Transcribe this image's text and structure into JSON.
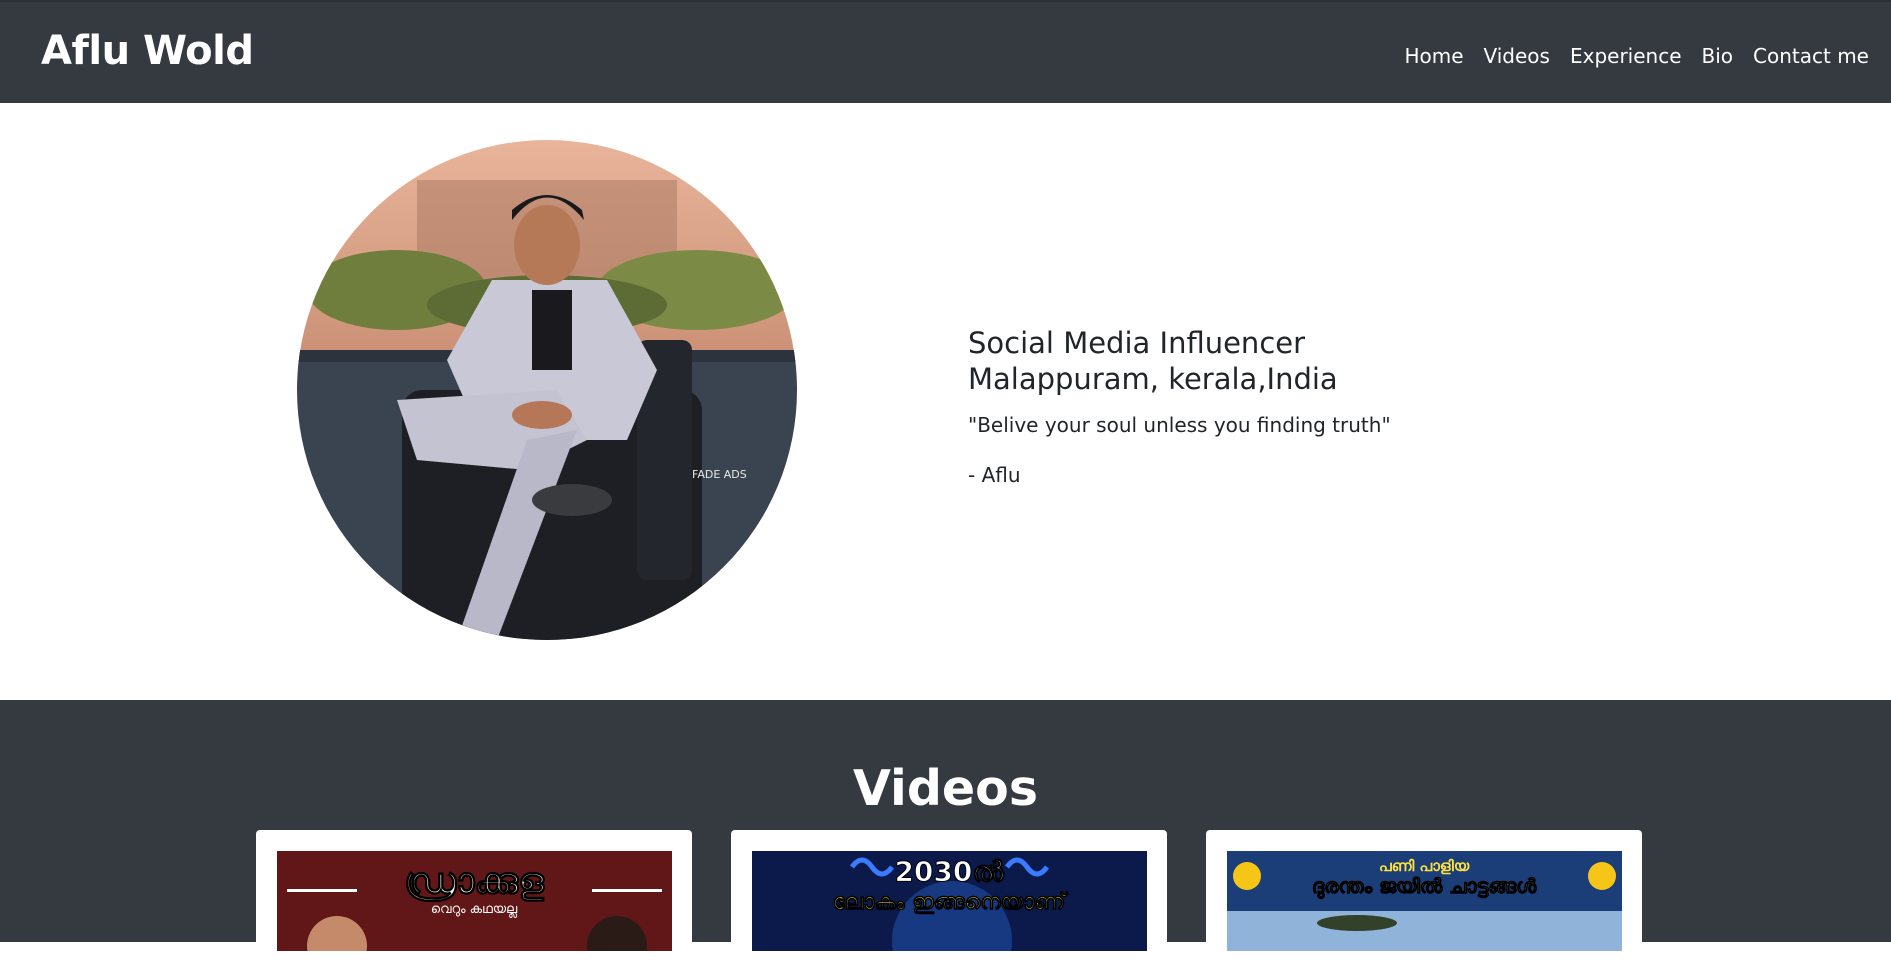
{
  "navbar": {
    "brand": "Aflu Wold",
    "links": [
      "Home",
      "Videos",
      "Experience",
      "Bio",
      "Contact me"
    ]
  },
  "hero": {
    "title_line1": "Social Media Influencer",
    "title_line2": "Malappuram, kerala,India",
    "quote": "\"Belive your soul unless you finding truth\"",
    "author": "- Aflu",
    "photo_watermark": "FADE ADS"
  },
  "videos": {
    "heading": "Videos",
    "cards": [
      {
        "title": "ഡ്രാക്കുള",
        "subtitle": "വെറും കഥയല്ല"
      },
      {
        "title": "2030ൽ",
        "subtitle": "ലോകം ഇങ്ങനെയാണ്"
      },
      {
        "title": "പണി പാളിയ",
        "subtitle": "ദുരന്തം ജയിൽ ചാട്ടങ്ങൾ"
      }
    ]
  },
  "colors": {
    "navbar_bg": "#343a40",
    "videos_bg": "#343a40",
    "text_light": "#ffffff",
    "text_dark": "#212529"
  }
}
